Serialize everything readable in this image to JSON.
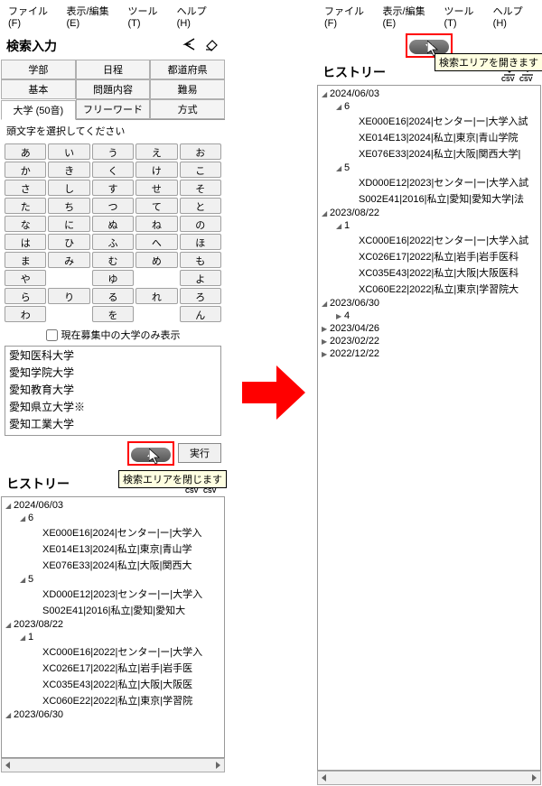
{
  "menu": {
    "file": "ファイル(F)",
    "view": "表示/編集(E)",
    "tool": "ツール(T)",
    "help": "ヘルプ(H)"
  },
  "searchinput": {
    "title": "検索入力",
    "tabs": {
      "gakubu": "学部",
      "nittei": "日程",
      "pref": "都道府県",
      "kihon": "基本",
      "naiyo": "問題内容",
      "nani": "難易",
      "univ": "大学 (50音)",
      "free": "フリーワード",
      "method": "方式"
    },
    "subtitle": "頭文字を選択してください",
    "kana": [
      "あ",
      "い",
      "う",
      "え",
      "お",
      "か",
      "き",
      "く",
      "け",
      "こ",
      "さ",
      "し",
      "す",
      "せ",
      "そ",
      "た",
      "ち",
      "つ",
      "て",
      "と",
      "な",
      "に",
      "ぬ",
      "ね",
      "の",
      "は",
      "ひ",
      "ふ",
      "へ",
      "ほ",
      "ま",
      "み",
      "む",
      "め",
      "も",
      "や",
      "",
      "ゆ",
      "",
      "よ",
      "ら",
      "り",
      "る",
      "れ",
      "ろ",
      "わ",
      "",
      "を",
      "",
      "ん"
    ],
    "checkbox": "現在募集中の大学のみ表示",
    "list": [
      "愛知医科大学",
      "愛知学院大学",
      "愛知教育大学",
      "愛知県立大学※",
      "愛知工業大学"
    ],
    "exec": "実行"
  },
  "tooltip_close": "検索エリアを閉じます",
  "tooltip_open": "検索エリアを開きます",
  "history": {
    "title": "ヒストリー",
    "csv": "CSV",
    "treeLeft": [
      {
        "lvl": 0,
        "t": "▲",
        "text": "2024/06/03"
      },
      {
        "lvl": 1,
        "t": "▲",
        "text": "6"
      },
      {
        "lvl": 2,
        "t": "",
        "text": "XE000E16|2024|センター|ー|大学入"
      },
      {
        "lvl": 2,
        "t": "",
        "text": "XE014E13|2024|私立|東京|青山学"
      },
      {
        "lvl": 2,
        "t": "",
        "text": "XE076E33|2024|私立|大阪|関西大"
      },
      {
        "lvl": 1,
        "t": "▲",
        "text": "5"
      },
      {
        "lvl": 2,
        "t": "",
        "text": "XD000E12|2023|センター|ー|大学入"
      },
      {
        "lvl": 2,
        "t": "",
        "text": "S002E41|2016|私立|愛知|愛知大"
      },
      {
        "lvl": 0,
        "t": "▲",
        "text": "2023/08/22"
      },
      {
        "lvl": 1,
        "t": "▲",
        "text": "1"
      },
      {
        "lvl": 2,
        "t": "",
        "text": "XC000E16|2022|センター|ー|大学入"
      },
      {
        "lvl": 2,
        "t": "",
        "text": "XC026E17|2022|私立|岩手|岩手医"
      },
      {
        "lvl": 2,
        "t": "",
        "text": "XC035E43|2022|私立|大阪|大阪医"
      },
      {
        "lvl": 2,
        "t": "",
        "text": "XC060E22|2022|私立|東京|学習院"
      },
      {
        "lvl": 0,
        "t": "▲",
        "text": "2023/06/30"
      }
    ],
    "treeRight": [
      {
        "lvl": 0,
        "t": "▲",
        "text": "2024/06/03"
      },
      {
        "lvl": 1,
        "t": "▲",
        "text": "6"
      },
      {
        "lvl": 2,
        "t": "",
        "text": "XE000E16|2024|センター|ー|大学入試"
      },
      {
        "lvl": 2,
        "t": "",
        "text": "XE014E13|2024|私立|東京|青山学院"
      },
      {
        "lvl": 2,
        "t": "",
        "text": "XE076E33|2024|私立|大阪|関西大学|"
      },
      {
        "lvl": 1,
        "t": "▲",
        "text": "5"
      },
      {
        "lvl": 2,
        "t": "",
        "text": "XD000E12|2023|センター|ー|大学入試"
      },
      {
        "lvl": 2,
        "t": "",
        "text": "S002E41|2016|私立|愛知|愛知大学|法"
      },
      {
        "lvl": 0,
        "t": "▲",
        "text": "2023/08/22"
      },
      {
        "lvl": 1,
        "t": "▲",
        "text": "1"
      },
      {
        "lvl": 2,
        "t": "",
        "text": "XC000E16|2022|センター|ー|大学入試"
      },
      {
        "lvl": 2,
        "t": "",
        "text": "XC026E17|2022|私立|岩手|岩手医科"
      },
      {
        "lvl": 2,
        "t": "",
        "text": "XC035E43|2022|私立|大阪|大阪医科"
      },
      {
        "lvl": 2,
        "t": "",
        "text": "XC060E22|2022|私立|東京|学習院大"
      },
      {
        "lvl": 0,
        "t": "▲",
        "text": "2023/06/30"
      },
      {
        "lvl": 1,
        "t": "▶",
        "text": "4"
      },
      {
        "lvl": 0,
        "t": "▶",
        "text": "2023/04/26"
      },
      {
        "lvl": 0,
        "t": "▶",
        "text": "2023/02/22"
      },
      {
        "lvl": 0,
        "t": "▶",
        "text": "2022/12/22"
      }
    ]
  }
}
